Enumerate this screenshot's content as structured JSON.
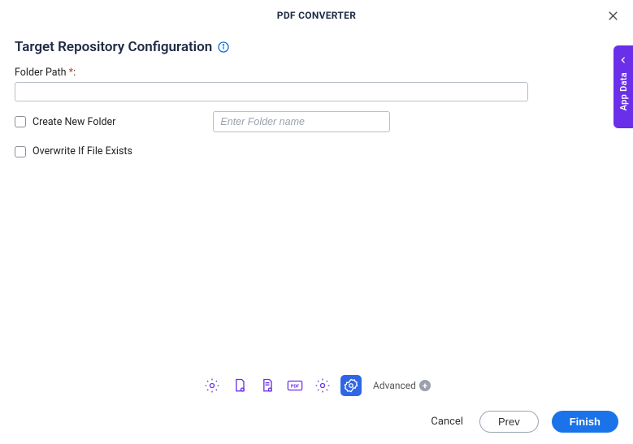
{
  "header": {
    "title": "PDF CONVERTER"
  },
  "section": {
    "title": "Target Repository Configuration",
    "folder_path_label": "Folder Path",
    "folder_path_required": "*",
    "folder_path_colon": ":",
    "folder_path_value": "",
    "create_new_folder_label": "Create New Folder",
    "folder_name_placeholder": "Enter Folder name",
    "folder_name_value": "",
    "overwrite_label": "Overwrite If File Exists"
  },
  "side_tab": {
    "label": "App Data"
  },
  "footer": {
    "advanced_label": "Advanced",
    "cancel": "Cancel",
    "prev": "Prev",
    "finish": "Finish"
  }
}
